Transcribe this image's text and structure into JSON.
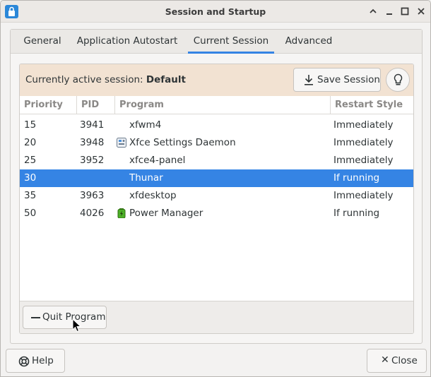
{
  "window": {
    "title": "Session and Startup"
  },
  "tabs": [
    {
      "label": "General"
    },
    {
      "label": "Application Autostart"
    },
    {
      "label": "Current Session"
    },
    {
      "label": "Advanced"
    }
  ],
  "infobar": {
    "label": "Currently active session:",
    "session_name": "Default",
    "save_label": "Save Session"
  },
  "table": {
    "headers": {
      "priority": "Priority",
      "pid": "PID",
      "program": "Program",
      "restart": "Restart Style"
    },
    "rows": [
      {
        "priority": "15",
        "pid": "3941",
        "program": "xfwm4",
        "restart": "Immediately",
        "icon": "none"
      },
      {
        "priority": "20",
        "pid": "3948",
        "program": "Xfce Settings Daemon",
        "restart": "Immediately",
        "icon": "settings-daemon-icon"
      },
      {
        "priority": "25",
        "pid": "3952",
        "program": "xfce4-panel",
        "restart": "Immediately",
        "icon": "none"
      },
      {
        "priority": "30",
        "pid": "",
        "program": "Thunar",
        "restart": "If running",
        "icon": "none",
        "selected": true
      },
      {
        "priority": "35",
        "pid": "3963",
        "program": "xfdesktop",
        "restart": "Immediately",
        "icon": "none"
      },
      {
        "priority": "50",
        "pid": "4026",
        "program": "Power Manager",
        "restart": "If running",
        "icon": "battery-icon"
      }
    ]
  },
  "footer": {
    "quit_label": "Quit Program",
    "help_label": "Help",
    "close_label": "Close"
  },
  "colors": {
    "accent": "#3584e4",
    "infobar_bg": "#f2e2d2"
  }
}
